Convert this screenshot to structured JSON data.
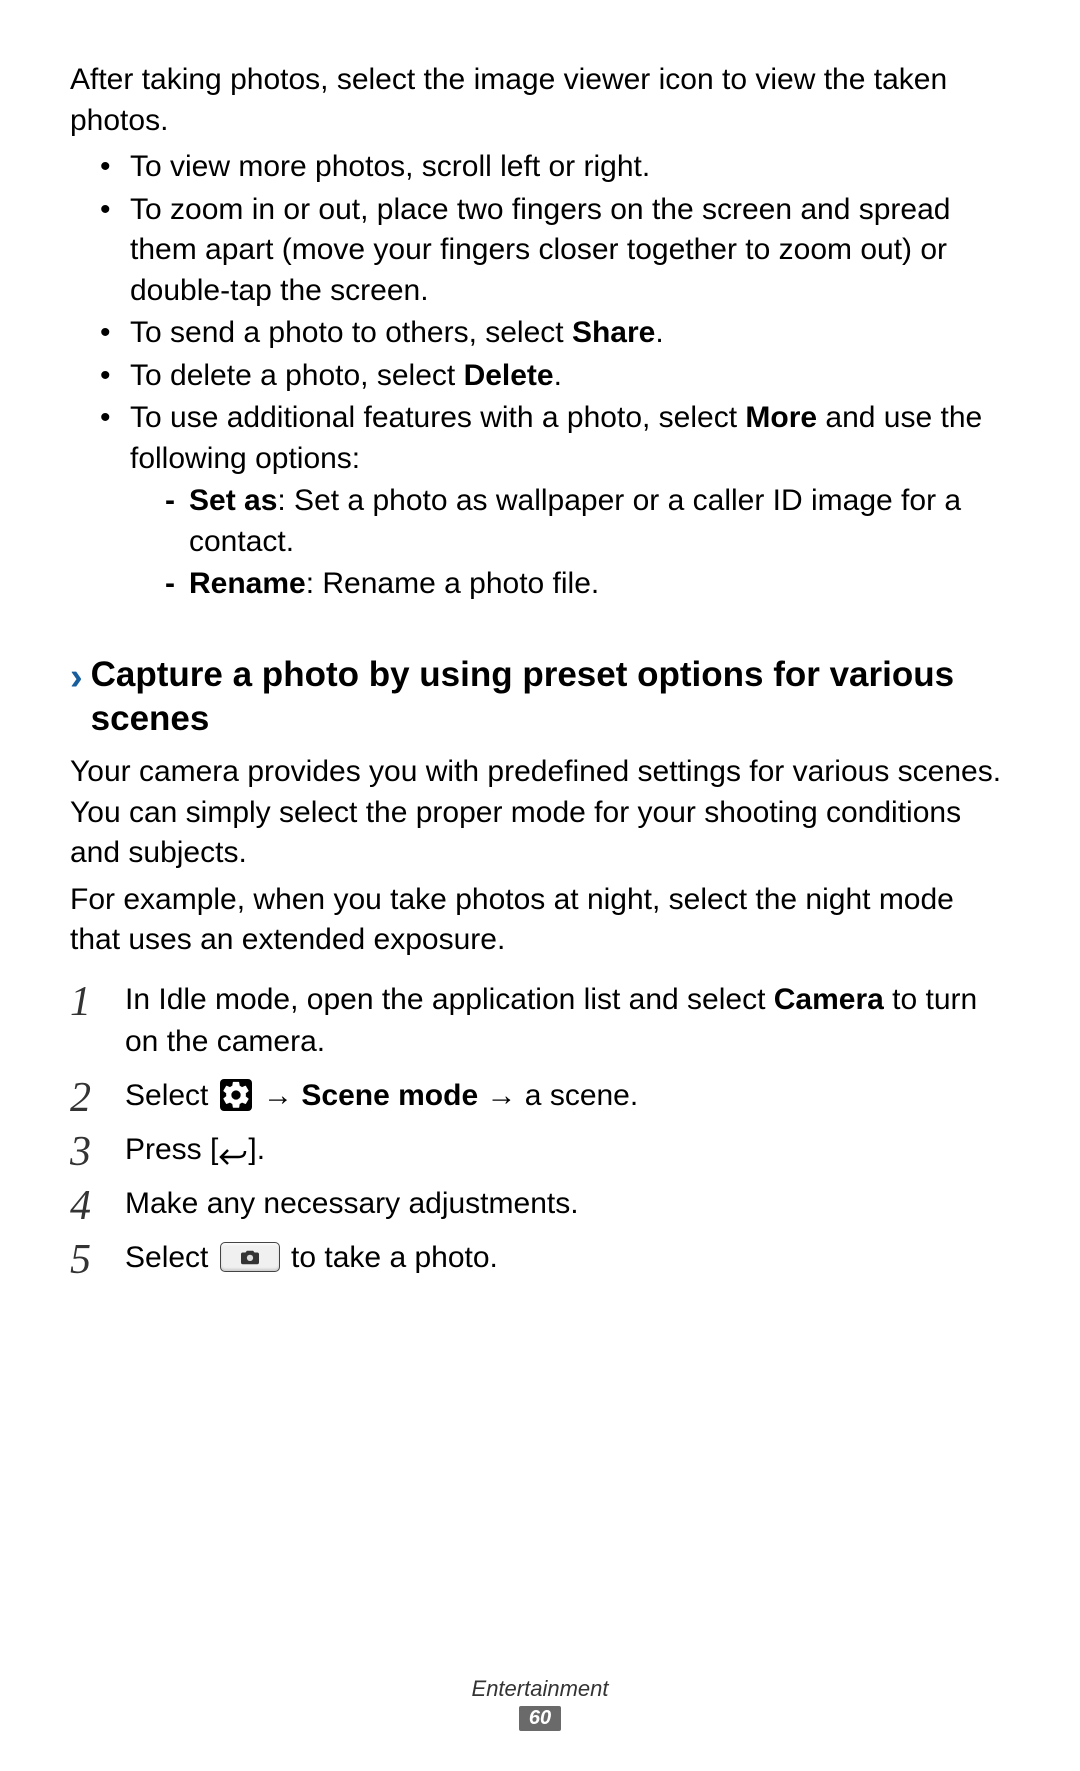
{
  "intro": "After taking photos, select the image viewer icon to view the taken photos.",
  "bullets": {
    "b0": "To view more photos, scroll left or right.",
    "b1": "To zoom in or out, place two fingers on the screen and spread them apart (move your fingers closer together to zoom out) or double-tap the screen.",
    "b2_pre": "To send a photo to others, select ",
    "b2_bold": "Share",
    "b2_post": ".",
    "b3_pre": "To delete a photo, select ",
    "b3_bold": "Delete",
    "b3_post": ".",
    "b4_pre": "To use additional features with a photo, select ",
    "b4_bold": "More",
    "b4_post": " and use the following options:",
    "dash0_bold": "Set as",
    "dash0_rest": ": Set a photo as wallpaper or a caller ID image for a contact.",
    "dash1_bold": "Rename",
    "dash1_rest": ": Rename a photo file."
  },
  "heading": "Capture a photo by using preset options for various scenes",
  "para1": "Your camera provides you with predefined settings for various scenes. You can simply select the proper mode for your shooting conditions and subjects.",
  "para2": "For example, when you take photos at night, select the night mode that uses an extended exposure.",
  "steps": {
    "s1_pre": "In Idle mode, open the application list and select ",
    "s1_bold": "Camera",
    "s1_post": " to turn on the camera.",
    "s2_pre": "Select ",
    "s2_arrow1": " → ",
    "s2_bold": "Scene mode",
    "s2_arrow2": " → ",
    "s2_post": "a scene.",
    "s3_pre": "Press [",
    "s3_post": "].",
    "s4": "Make any necessary adjustments.",
    "s5_pre": "Select ",
    "s5_post": " to take a photo."
  },
  "footer": {
    "section": "Entertainment",
    "page": "60"
  }
}
